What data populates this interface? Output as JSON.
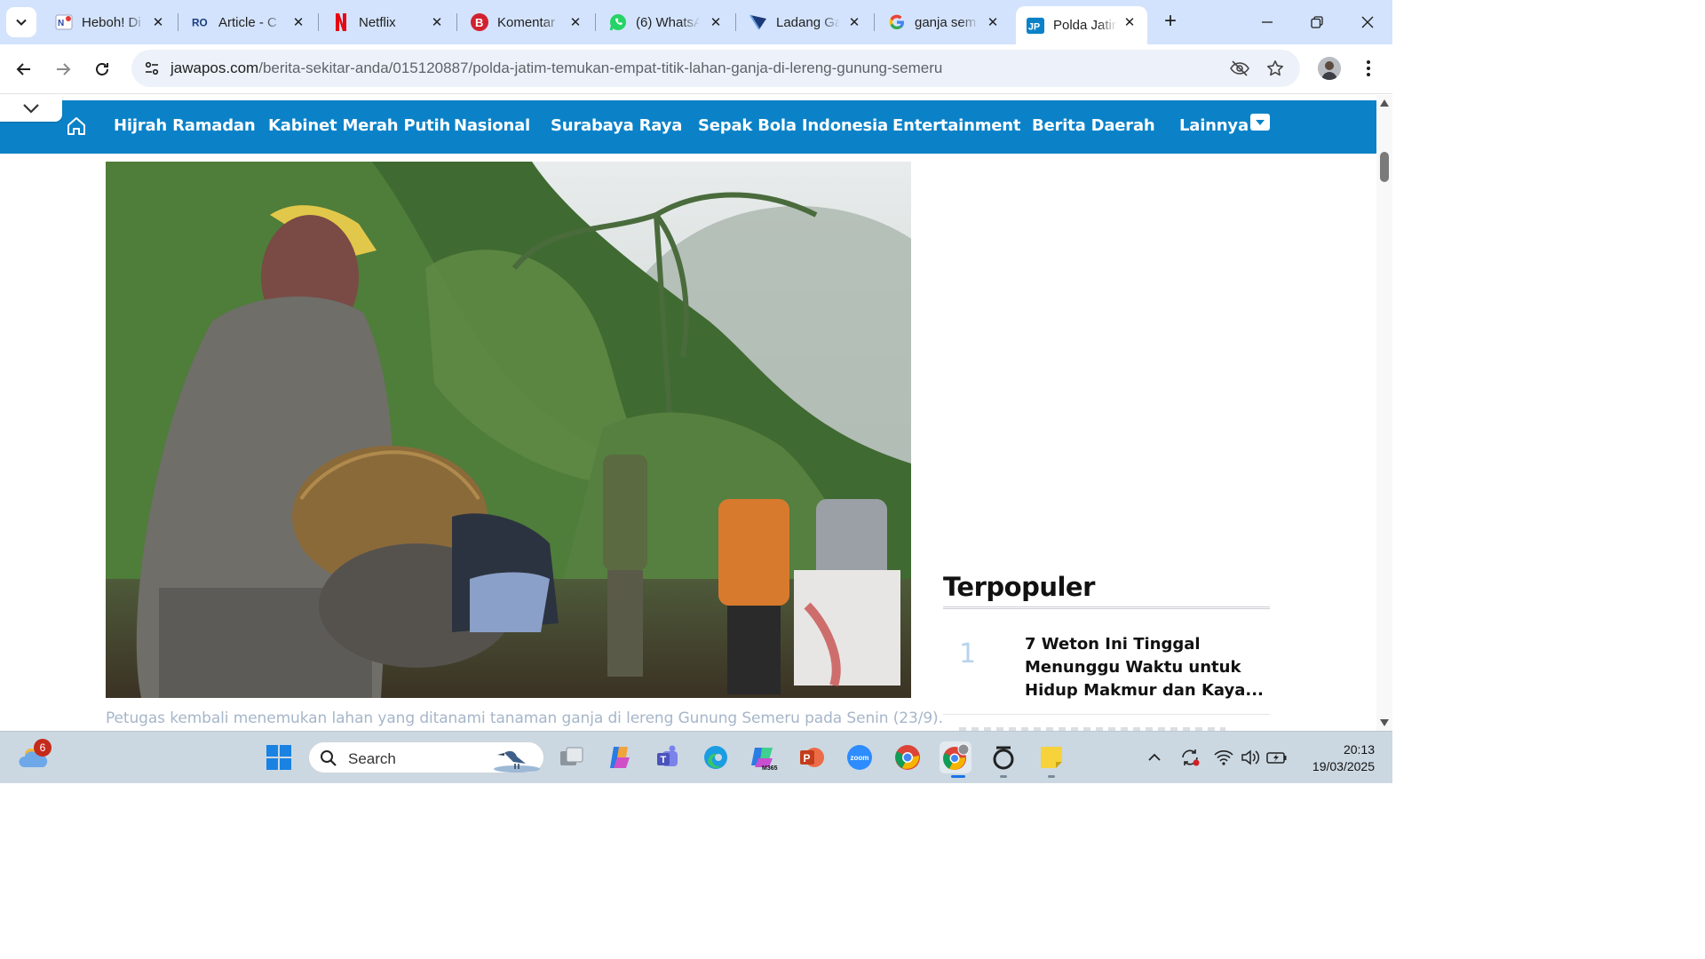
{
  "browser": {
    "tabs": [
      {
        "title": "Heboh! Di",
        "favicon": "news-favicon",
        "active": false
      },
      {
        "title": "Article - C",
        "favicon": "ro-favicon",
        "active": false
      },
      {
        "title": "Netflix",
        "favicon": "netflix-favicon",
        "active": false
      },
      {
        "title": "Komentar",
        "favicon": "b-favicon",
        "active": false
      },
      {
        "title": "(6) WhatsA",
        "favicon": "whatsapp-favicon",
        "active": false
      },
      {
        "title": "Ladang Ga",
        "favicon": "ladang-favicon",
        "active": false
      },
      {
        "title": "ganja sem",
        "favicon": "google-favicon",
        "active": false
      },
      {
        "title": "Polda Jatin",
        "favicon": "jp-favicon",
        "active": true
      }
    ],
    "new_tab_label": "+",
    "url_host": "jawapos.com",
    "url_path": "/berita-sekitar-anda/015120887/polda-jatim-temukan-empat-titik-lahan-ganja-di-lereng-gunung-semeru"
  },
  "site": {
    "brand_color": "#0b82c8",
    "nav": [
      "Hijrah Ramadan",
      "Kabinet Merah Putih",
      "Nasional",
      "Surabaya Raya",
      "Sepak Bola Indonesia",
      "Entertainment",
      "Berita Daerah",
      "Lainnya"
    ],
    "caption": "Petugas kembali menemukan lahan yang ditanami tanaman ganja di lereng Gunung Semeru pada Senin (23/9).",
    "sidebar": {
      "title": "Terpopuler",
      "items": [
        {
          "rank": "1",
          "title_lines": [
            "7 Weton Ini Tinggal",
            "Menunggu Waktu untuk",
            "Hidup Makmur dan Kaya..."
          ]
        }
      ]
    }
  },
  "taskbar": {
    "weather_badge": "6",
    "search_label": "Search",
    "apps": [
      "task-view",
      "copilot",
      "teams",
      "edge",
      "microsoft-365",
      "powerpoint",
      "zoom",
      "chrome",
      "chrome-profile",
      "circle-app",
      "sticky-notes"
    ],
    "time": "20:13",
    "date": "19/03/2025"
  }
}
